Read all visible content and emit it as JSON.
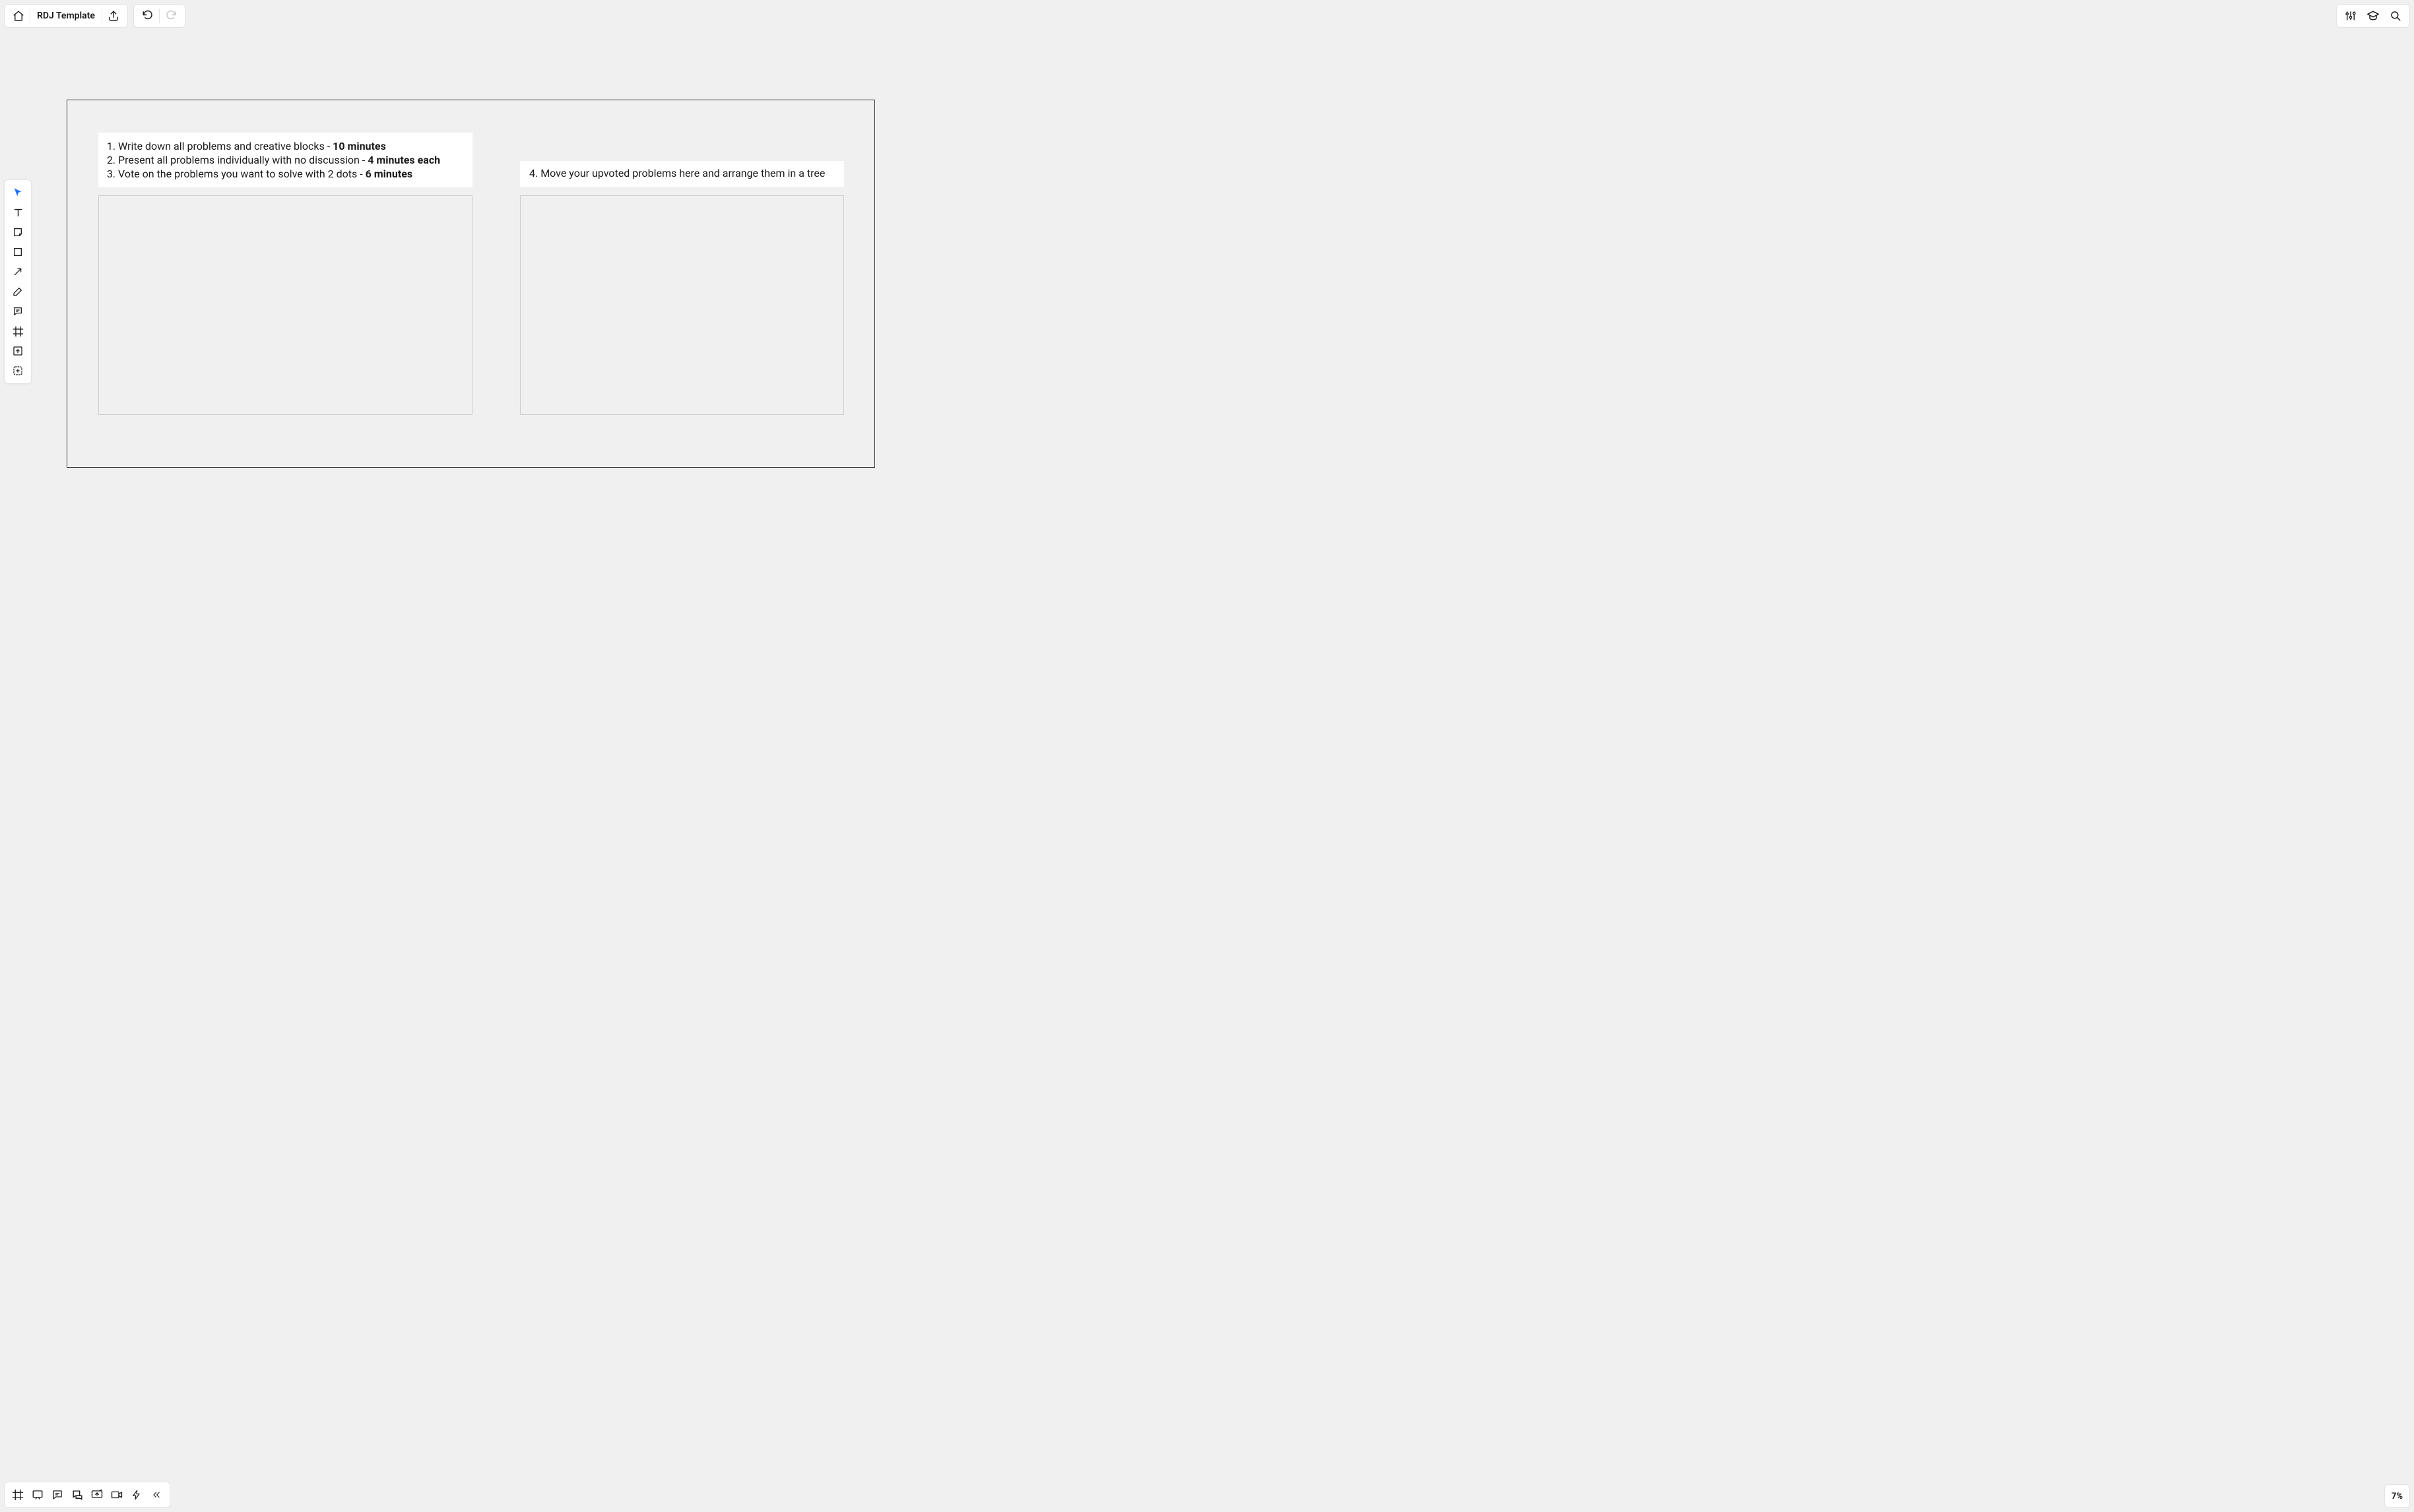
{
  "header": {
    "title": "RDJ Template"
  },
  "zoom": {
    "label": "7%"
  },
  "icons": {
    "home": "home-icon",
    "export": "export-icon",
    "undo": "undo-icon",
    "redo": "redo-icon",
    "settings": "settings-icon",
    "learn": "academic-cap-icon",
    "search": "search-icon"
  },
  "left_tools": [
    "select-tool",
    "text-tool",
    "sticky-note-tool",
    "shape-tool",
    "connection-line-tool",
    "pen-tool",
    "comment-tool",
    "frame-tool",
    "upload-tool",
    "more-tool"
  ],
  "bottom_tools": [
    "frames-panel",
    "presentation-panel",
    "comments-panel",
    "chat-panel",
    "screen-share-panel",
    "recording-panel",
    "activities-panel",
    "collapse-panel"
  ],
  "canvas": {
    "left_block": {
      "items": [
        {
          "num": "1.",
          "text": "Write down all problems and creative blocks - ",
          "bold": "10 minutes"
        },
        {
          "num": "2.",
          "text": "Present all problems individually with no discussion - ",
          "bold": "4 minutes each"
        },
        {
          "num": "3.",
          "text": "Vote on the problems you want to solve with 2 dots - ",
          "bold": "6 minutes"
        }
      ]
    },
    "right_block": {
      "num": "4.",
      "text": "Move your upvoted problems here and arrange them in a tree"
    }
  }
}
